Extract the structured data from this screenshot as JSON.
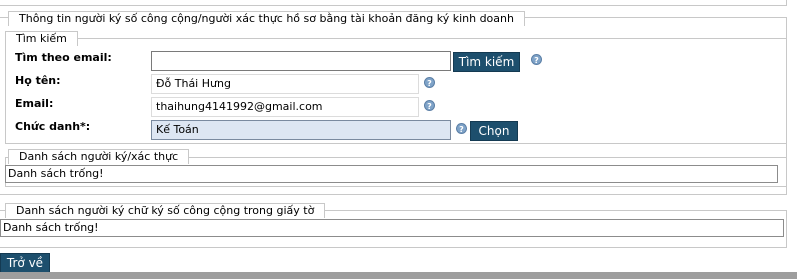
{
  "section_main": {
    "legend": "Thông tin người ký số công cộng/người xác thực hồ sơ bằng tài khoản đăng ký kinh doanh"
  },
  "search_section": {
    "legend": "Tìm kiếm",
    "email_search_label": "Tìm theo email:",
    "email_search_value": "",
    "search_button": "Tìm kiếm",
    "fullname_label": "Họ tên:",
    "fullname_value": "Đỗ Thái Hưng",
    "email_label": "Email:",
    "email_value": "thaihung4141992@gmail.com",
    "title_label": "Chức danh*:",
    "title_value": "Kế Toán",
    "choose_button": "Chọn",
    "help_glyph": "?"
  },
  "signers_section": {
    "legend": "Danh sách người ký/xác thực",
    "list_text": "Danh sách trống!"
  },
  "public_signers_section": {
    "legend": "Danh sách người ký chữ ký số công cộng trong giấy tờ",
    "list_text": "Danh sách trống!"
  },
  "back_button": "Trở về",
  "icons": [
    "help-icon"
  ]
}
